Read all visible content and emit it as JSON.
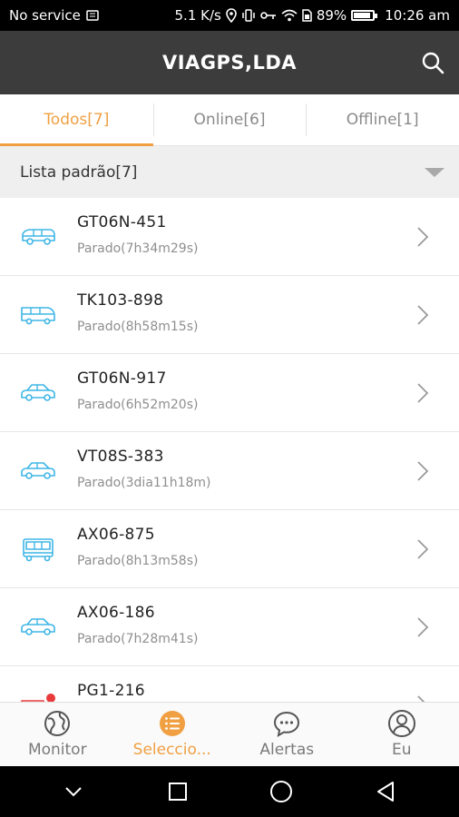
{
  "status_bar": {
    "carrier": "No service",
    "speed": "5.1 K/s",
    "battery": "89%",
    "battery_level": 0.89,
    "time": "10:26 am"
  },
  "header": {
    "title": "VIAGPS,LDA",
    "search_icon": "search-icon"
  },
  "tabs": [
    {
      "label": "Todos[7]",
      "active": true
    },
    {
      "label": "Online[6]",
      "active": false
    },
    {
      "label": "Offline[1]",
      "active": false
    }
  ],
  "group": {
    "title": "Lista padrão[7]",
    "icon": "dropdown-triangle-icon"
  },
  "devices": [
    {
      "name": "GT06N-451",
      "status": "Parado(7h34m29s)",
      "icon": "van-icon"
    },
    {
      "name": "TK103-898",
      "status": "Parado(8h58m15s)",
      "icon": "minibus-icon"
    },
    {
      "name": "GT06N-917",
      "status": "Parado(6h52m20s)",
      "icon": "car-icon"
    },
    {
      "name": "VT08S-383",
      "status": "Parado(3dia11h18m)",
      "icon": "car-icon"
    },
    {
      "name": "AX06-875",
      "status": "Parado(8h13m58s)",
      "icon": "bus-icon"
    },
    {
      "name": "AX06-186",
      "status": "Parado(7h28m41s)",
      "icon": "car-icon"
    },
    {
      "name": "PG1-216",
      "status": "",
      "icon": "truck-icon"
    }
  ],
  "colors": {
    "accent": "#f0a043",
    "header_bg": "#3c3c3c",
    "vehicle_icon": "#3fb6e6",
    "offline_icon": "#e83a3a"
  },
  "bottom_nav": [
    {
      "label": "Monitor",
      "icon": "globe-icon",
      "active": false
    },
    {
      "label": "Seleccio...",
      "icon": "list-icon",
      "active": true
    },
    {
      "label": "Alertas",
      "icon": "chat-bubble-icon",
      "active": false
    },
    {
      "label": "Eu",
      "icon": "user-icon",
      "active": false
    }
  ],
  "system_nav": [
    "back-chevron-icon",
    "recents-square-icon",
    "home-circle-icon",
    "back-triangle-icon"
  ]
}
